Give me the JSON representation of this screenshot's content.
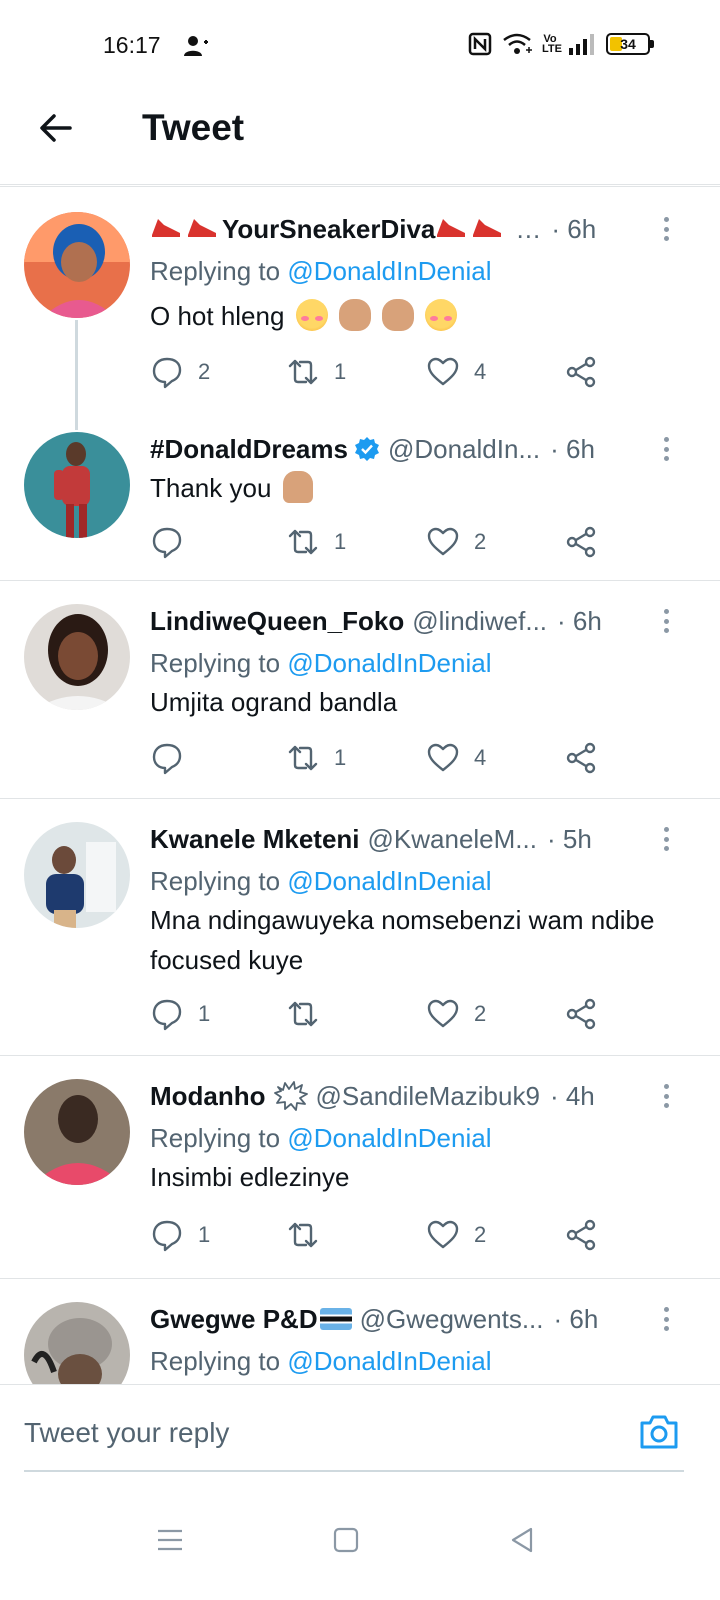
{
  "status_bar": {
    "time": "16:17",
    "battery": "34",
    "volte": "Vo LTE"
  },
  "header": {
    "title": "Tweet"
  },
  "tweets": [
    {
      "name": "YourSneakerDiva",
      "handle": "…",
      "time": "· 6h",
      "replying_prefix": "Replying to ",
      "replying_to": "@DonaldInDenial",
      "text": "O hot hleng",
      "reply_count": "2",
      "retweet_count": "1",
      "like_count": "4",
      "avatar_colors": [
        "#e85a8f",
        "#2d6fb0",
        "#f0a070"
      ]
    },
    {
      "name": "#DonaldDreams",
      "handle": "@DonaldIn...",
      "time": "· 6h",
      "text": "Thank you",
      "reply_count": "",
      "retweet_count": "1",
      "like_count": "2",
      "avatar_colors": [
        "#3a8f9a",
        "#c23a3a",
        "#2a2a2a"
      ]
    },
    {
      "name": "LindiweQueen_Foko",
      "handle": "@lindiwef...",
      "time": "· 6h",
      "replying_prefix": "Replying to ",
      "replying_to": "@DonaldInDenial",
      "text": "Umjita ogrand bandla",
      "reply_count": "",
      "retweet_count": "1",
      "like_count": "4",
      "avatar_colors": [
        "#d9d4cf",
        "#3a2a22",
        "#8a5a42"
      ]
    },
    {
      "name": "Kwanele Mketeni",
      "handle": "@KwaneleM...",
      "time": "· 5h",
      "replying_prefix": "Replying to ",
      "replying_to": "@DonaldInDenial",
      "text": "Mna ndingawuyeka nomsebenzi wam ndibe focused kuye",
      "reply_count": "1",
      "retweet_count": "",
      "like_count": "2",
      "avatar_colors": [
        "#dfe6e8",
        "#1e3a6e",
        "#6b4a3a"
      ]
    },
    {
      "name": "Modanho",
      "handle": "@SandileMazibuk9",
      "time": "· 4h",
      "replying_prefix": "Replying to ",
      "replying_to": "@DonaldInDenial",
      "text": "Insimbi edlezinye",
      "reply_count": "1",
      "retweet_count": "",
      "like_count": "2",
      "avatar_colors": [
        "#8a7a6a",
        "#e84a6a",
        "#3a2a22"
      ]
    },
    {
      "name": "Gwegwe P&D",
      "handle": "@Gwegwents...",
      "time": "· 6h",
      "replying_prefix": "Replying to ",
      "replying_to": "@DonaldInDenial",
      "avatar_colors": [
        "#9a9590",
        "#6a5040",
        "#222222"
      ]
    }
  ],
  "reply_bar": {
    "placeholder": "Tweet your reply"
  },
  "icons": {
    "back": "arrow-left-icon",
    "camera": "camera-icon",
    "reply": "comment-icon",
    "retweet": "retweet-icon",
    "like": "heart-icon",
    "share": "share-icon"
  },
  "colors": {
    "accent": "#1d9bf0",
    "secondary_text": "#536471",
    "primary_text": "#0f1419"
  }
}
